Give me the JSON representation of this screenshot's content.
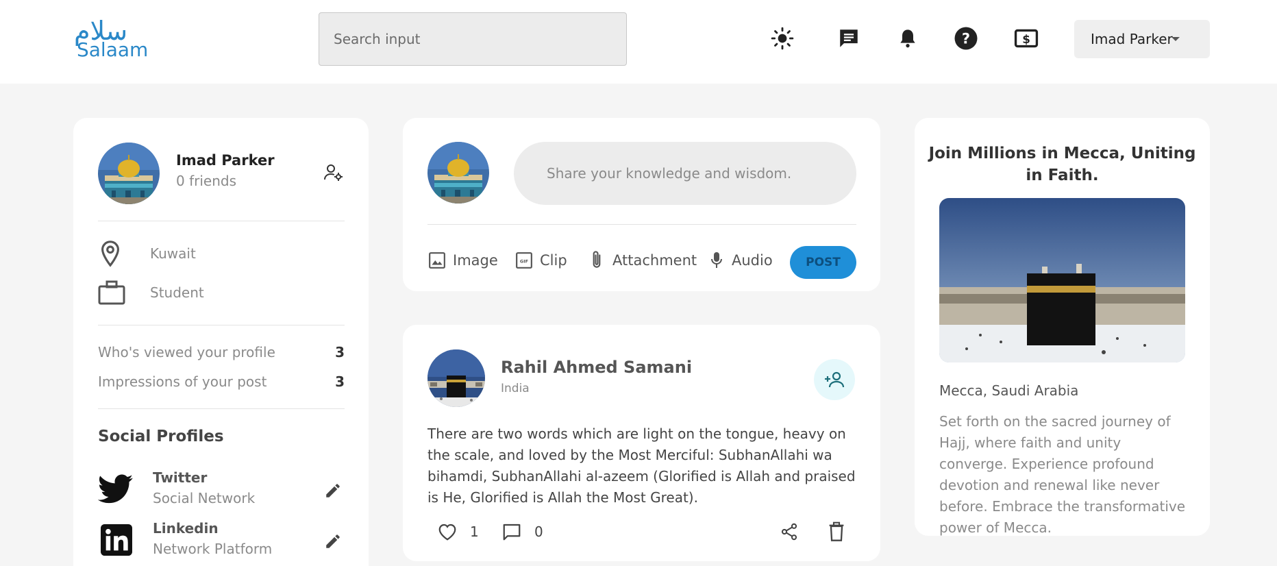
{
  "header": {
    "logo_arabic": "سلام",
    "logo_text": "Salaam",
    "search_placeholder": "Search input",
    "icons": [
      "sun-icon",
      "chat-icon",
      "bell-icon",
      "help-icon",
      "dollar-icon"
    ],
    "user_name": "Imad Parker"
  },
  "profile": {
    "name": "Imad Parker",
    "friends": "0 friends",
    "location": "Kuwait",
    "occupation": "Student",
    "stats": [
      {
        "label": "Who's viewed your profile",
        "value": "3"
      },
      {
        "label": "Impressions of your post",
        "value": "3"
      }
    ],
    "social_title": "Social Profiles",
    "socials": [
      {
        "name": "Twitter",
        "sub": "Social Network"
      },
      {
        "name": "Linkedin",
        "sub": "Network Platform"
      }
    ]
  },
  "composer": {
    "placeholder": "Share your knowledge and wisdom.",
    "tools": [
      "Image",
      "Clip",
      "Attachment",
      "Audio"
    ],
    "post_label": "POST"
  },
  "post": {
    "author": "Rahil Ahmed Samani",
    "location": "India",
    "text": "There are two words which are light on the tongue, heavy on the scale, and loved by the Most Merciful: SubhanAllahi wa bihamdi, SubhanAllahi al-azeem (Glorified is Allah and praised is He, Glorified is Allah the Most Great).",
    "likes": "1",
    "comments": "0"
  },
  "ad": {
    "title": "Join Millions in Mecca, Uniting in Faith.",
    "location": "Mecca, Saudi Arabia",
    "description": "Set forth on the sacred journey of Hajj, where faith and unity converge. Experience profound devotion and renewal like never before. Embrace the transformative power of Mecca."
  },
  "colors": {
    "brand": "#2a88c8",
    "post_button": "#1f8fd8",
    "background": "#f5f5f5"
  }
}
